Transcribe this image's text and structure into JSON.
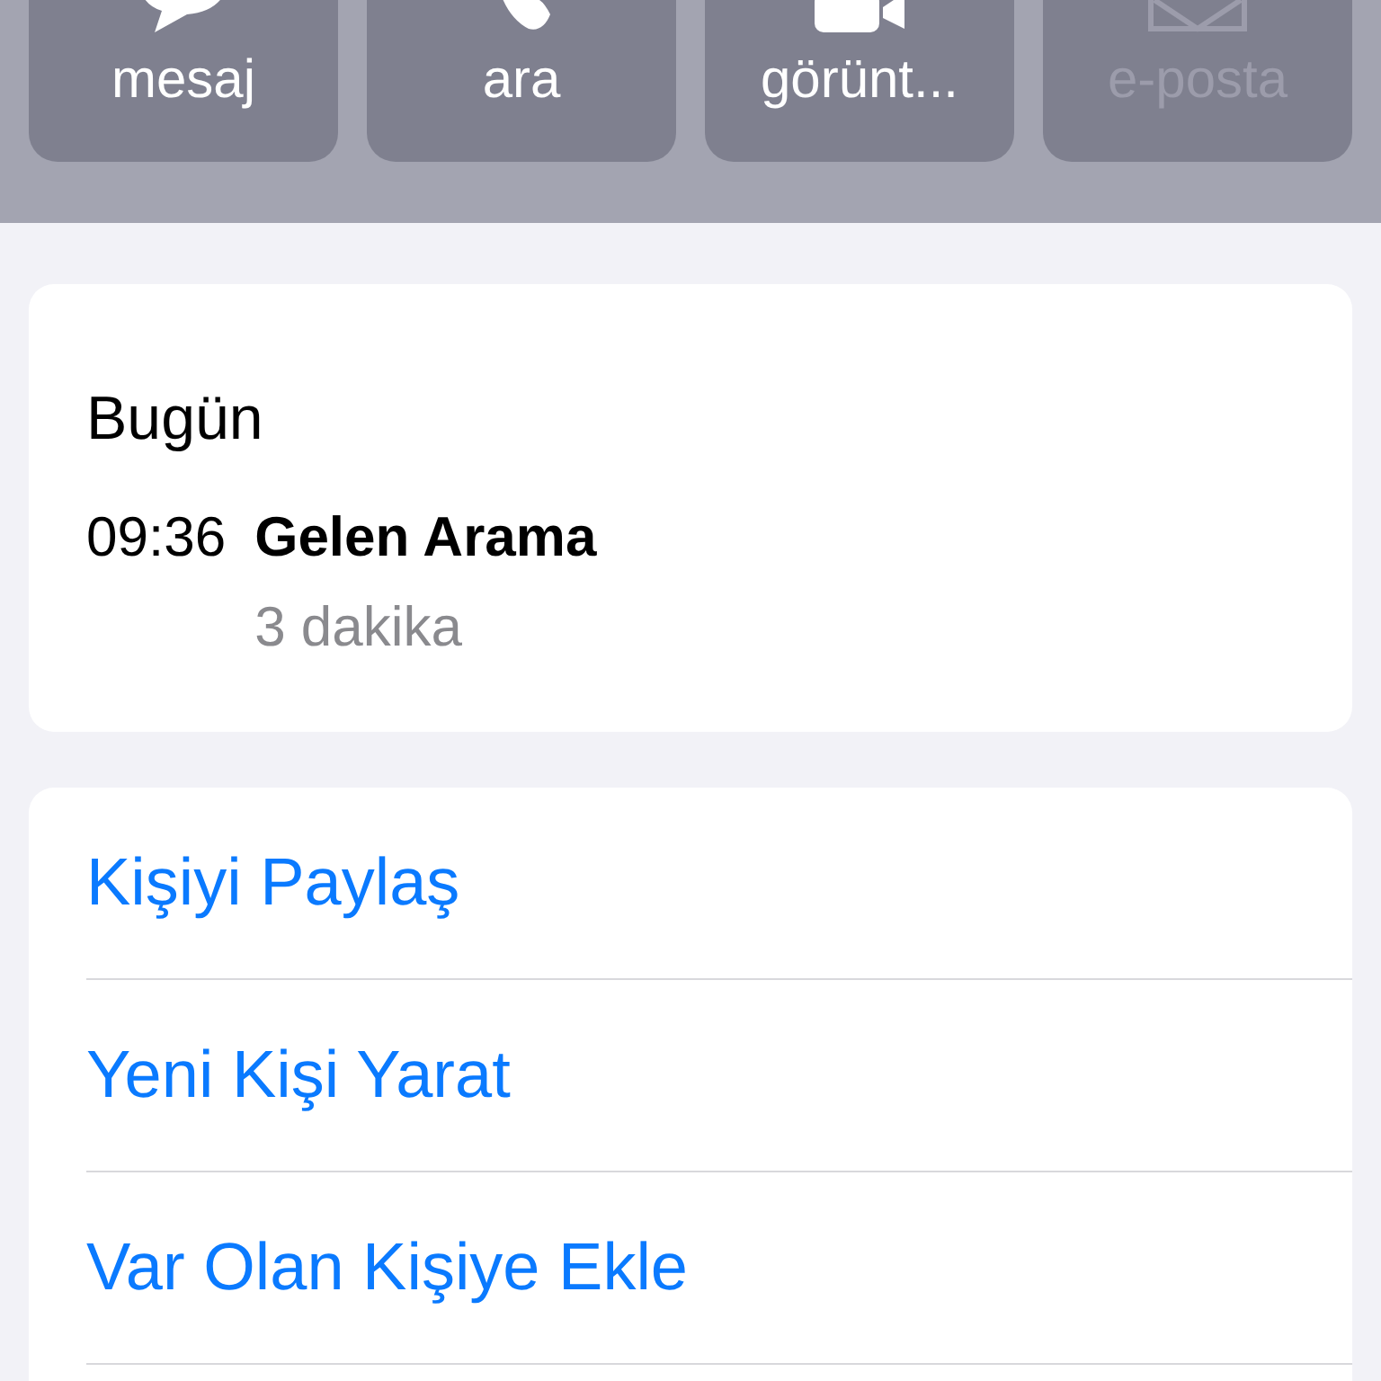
{
  "actions": [
    {
      "label": "mesaj",
      "kind": "message",
      "disabled": false
    },
    {
      "label": "ara",
      "kind": "phone",
      "disabled": false
    },
    {
      "label": "görünt...",
      "kind": "video",
      "disabled": false
    },
    {
      "label": "e-posta",
      "kind": "mail",
      "disabled": true
    }
  ],
  "history": {
    "heading": "Bugün",
    "calls": [
      {
        "time": "09:36",
        "type": "Gelen Arama",
        "duration": "3 dakika"
      }
    ]
  },
  "links": [
    "Kişiyi Paylaş",
    "Yeni Kişi Yarat",
    "Var Olan Kişiye Ekle"
  ]
}
